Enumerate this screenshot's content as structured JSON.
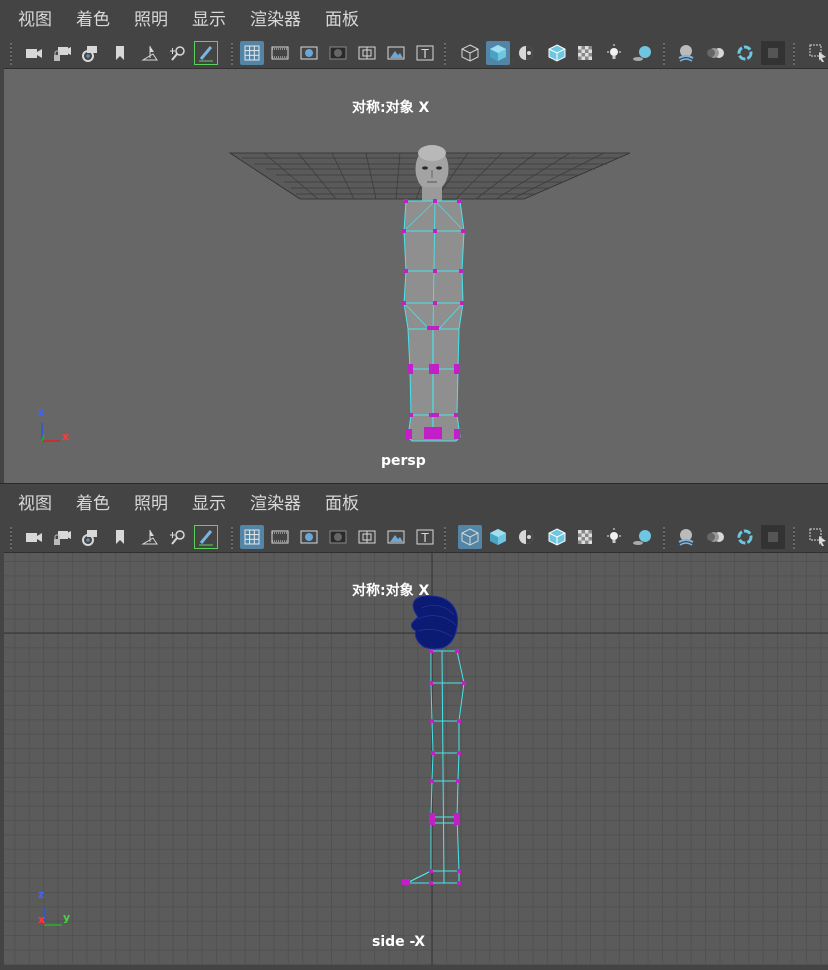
{
  "menus": [
    "视图",
    "着色",
    "照明",
    "显示",
    "渲染器",
    "面板"
  ],
  "toolbar_icons": [
    "camera-icon",
    "lock-camera-icon",
    "camera-attributes-icon",
    "bookmark-icon",
    "image-plane-icon",
    "2d-pan-zoom-icon",
    "grease-pencil-icon",
    "grid-icon",
    "film-gate-icon",
    "resolution-gate-icon",
    "gate-mask-icon",
    "field-chart-icon",
    "safe-action-icon",
    "safe-title-icon",
    "wireframe-icon",
    "smooth-shade-icon",
    "use-default-material-icon",
    "wireframe-on-shaded-icon",
    "xray-icon",
    "default-lighting-icon",
    "shadows-icon",
    "screen-space-ao-icon",
    "motion-blur-icon",
    "anti-aliasing-icon",
    "depth-of-field-icon",
    "isolate-select-icon"
  ],
  "top_panel": {
    "object_label": "对称:对象 X",
    "camera_name": "persp",
    "axes": {
      "z": "z",
      "x": "x"
    }
  },
  "bottom_panel": {
    "object_label": "对称:对象 X",
    "camera_name": "side -X",
    "axes": {
      "z": "z",
      "x": "x",
      "y": "y"
    }
  },
  "colors": {
    "accent_active": "#5285a6",
    "wire": "#49e4ea",
    "vertex": "#c21fc9",
    "side_head": "#0b1a73"
  }
}
